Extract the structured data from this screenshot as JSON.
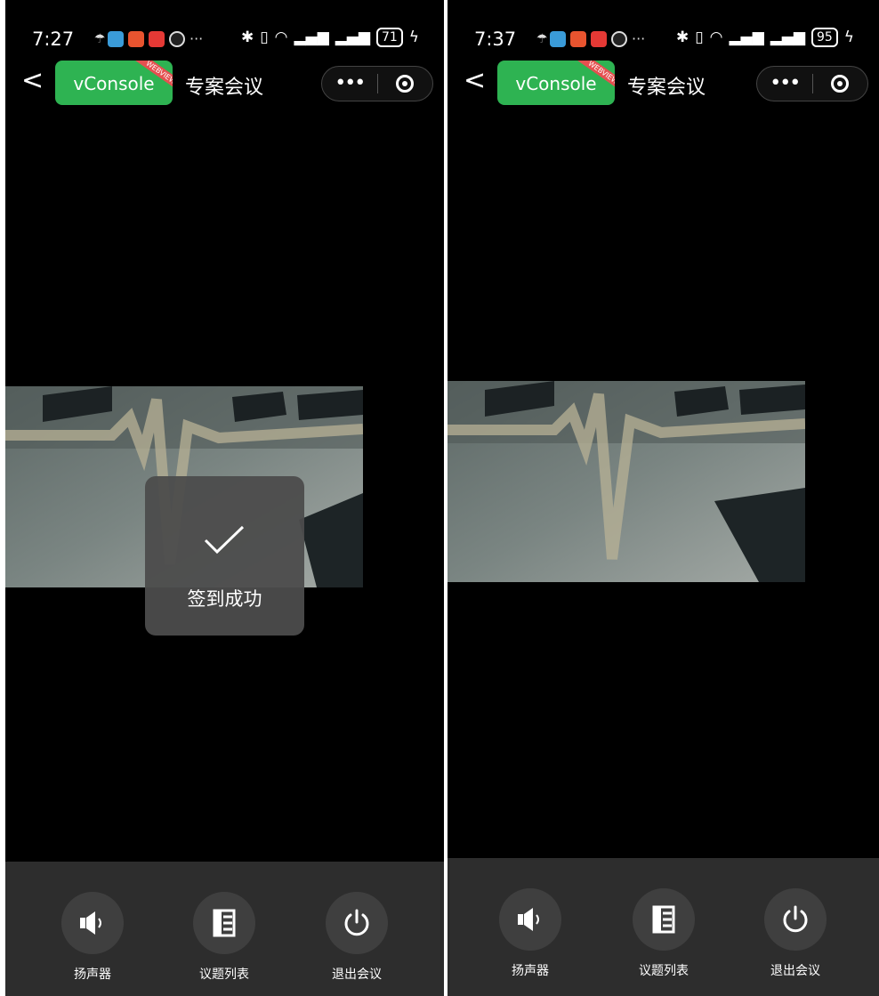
{
  "screens": [
    {
      "status": {
        "time": "7:27",
        "battery": "71"
      },
      "nav": {
        "back": "<",
        "vconsole": "vConsole",
        "ribbon": "WEBVIEW",
        "title": "专案会议",
        "more": "•••"
      },
      "toast": {
        "text": "签到成功"
      },
      "controls": [
        {
          "label": "扬声器",
          "icon": "speaker-icon"
        },
        {
          "label": "议题列表",
          "icon": "agenda-list-icon"
        },
        {
          "label": "退出会议",
          "icon": "power-icon"
        }
      ]
    },
    {
      "status": {
        "time": "7:37",
        "battery": "95"
      },
      "nav": {
        "back": "<",
        "vconsole": "vConsole",
        "ribbon": "WEBVIEW",
        "title": "专案会议",
        "more": "•••"
      },
      "controls": [
        {
          "label": "扬声器",
          "icon": "speaker-icon"
        },
        {
          "label": "议题列表",
          "icon": "agenda-list-icon"
        },
        {
          "label": "退出会议",
          "icon": "power-icon"
        }
      ]
    }
  ],
  "colors": {
    "vconsole_green": "#2eb352",
    "bar_bg": "#2d2d2d",
    "button_bg": "#3f3f3f",
    "toast_bg": "#4c4c4c"
  }
}
